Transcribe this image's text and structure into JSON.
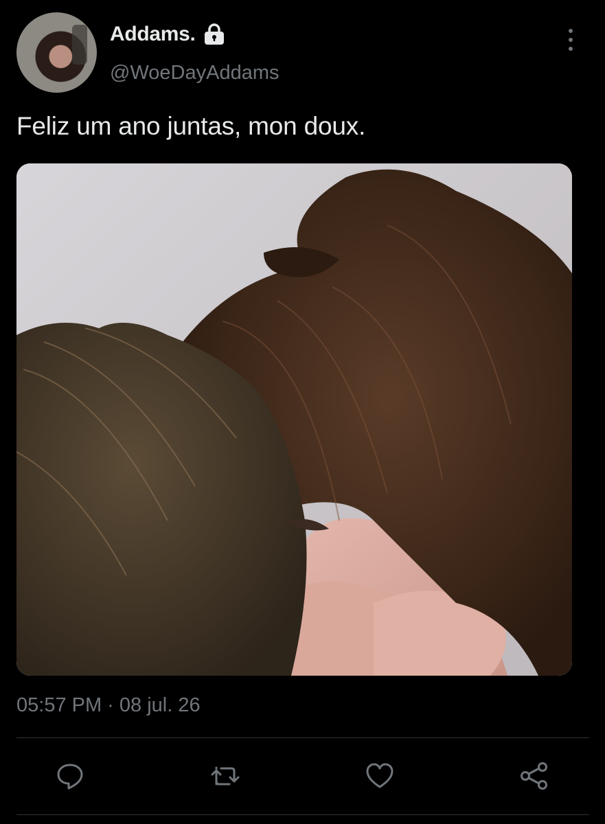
{
  "profile": {
    "display_name": "Addams.",
    "handle": "@WoeDayAddams",
    "protected_icon": "lock-icon",
    "avatar": "avatar-photo"
  },
  "tweet": {
    "text": "Feliz um ano juntas, mon doux.",
    "media": "photo",
    "timestamp": "05:57 PM · 08 jul. 26"
  },
  "actions": [
    {
      "icon": "reply-icon"
    },
    {
      "icon": "retweet-icon"
    },
    {
      "icon": "like-icon"
    },
    {
      "icon": "share-icon"
    }
  ],
  "colors": {
    "background": "#000000",
    "primary_text": "#e7e9ea",
    "secondary_text": "#71767b",
    "divider": "#2f3336"
  }
}
